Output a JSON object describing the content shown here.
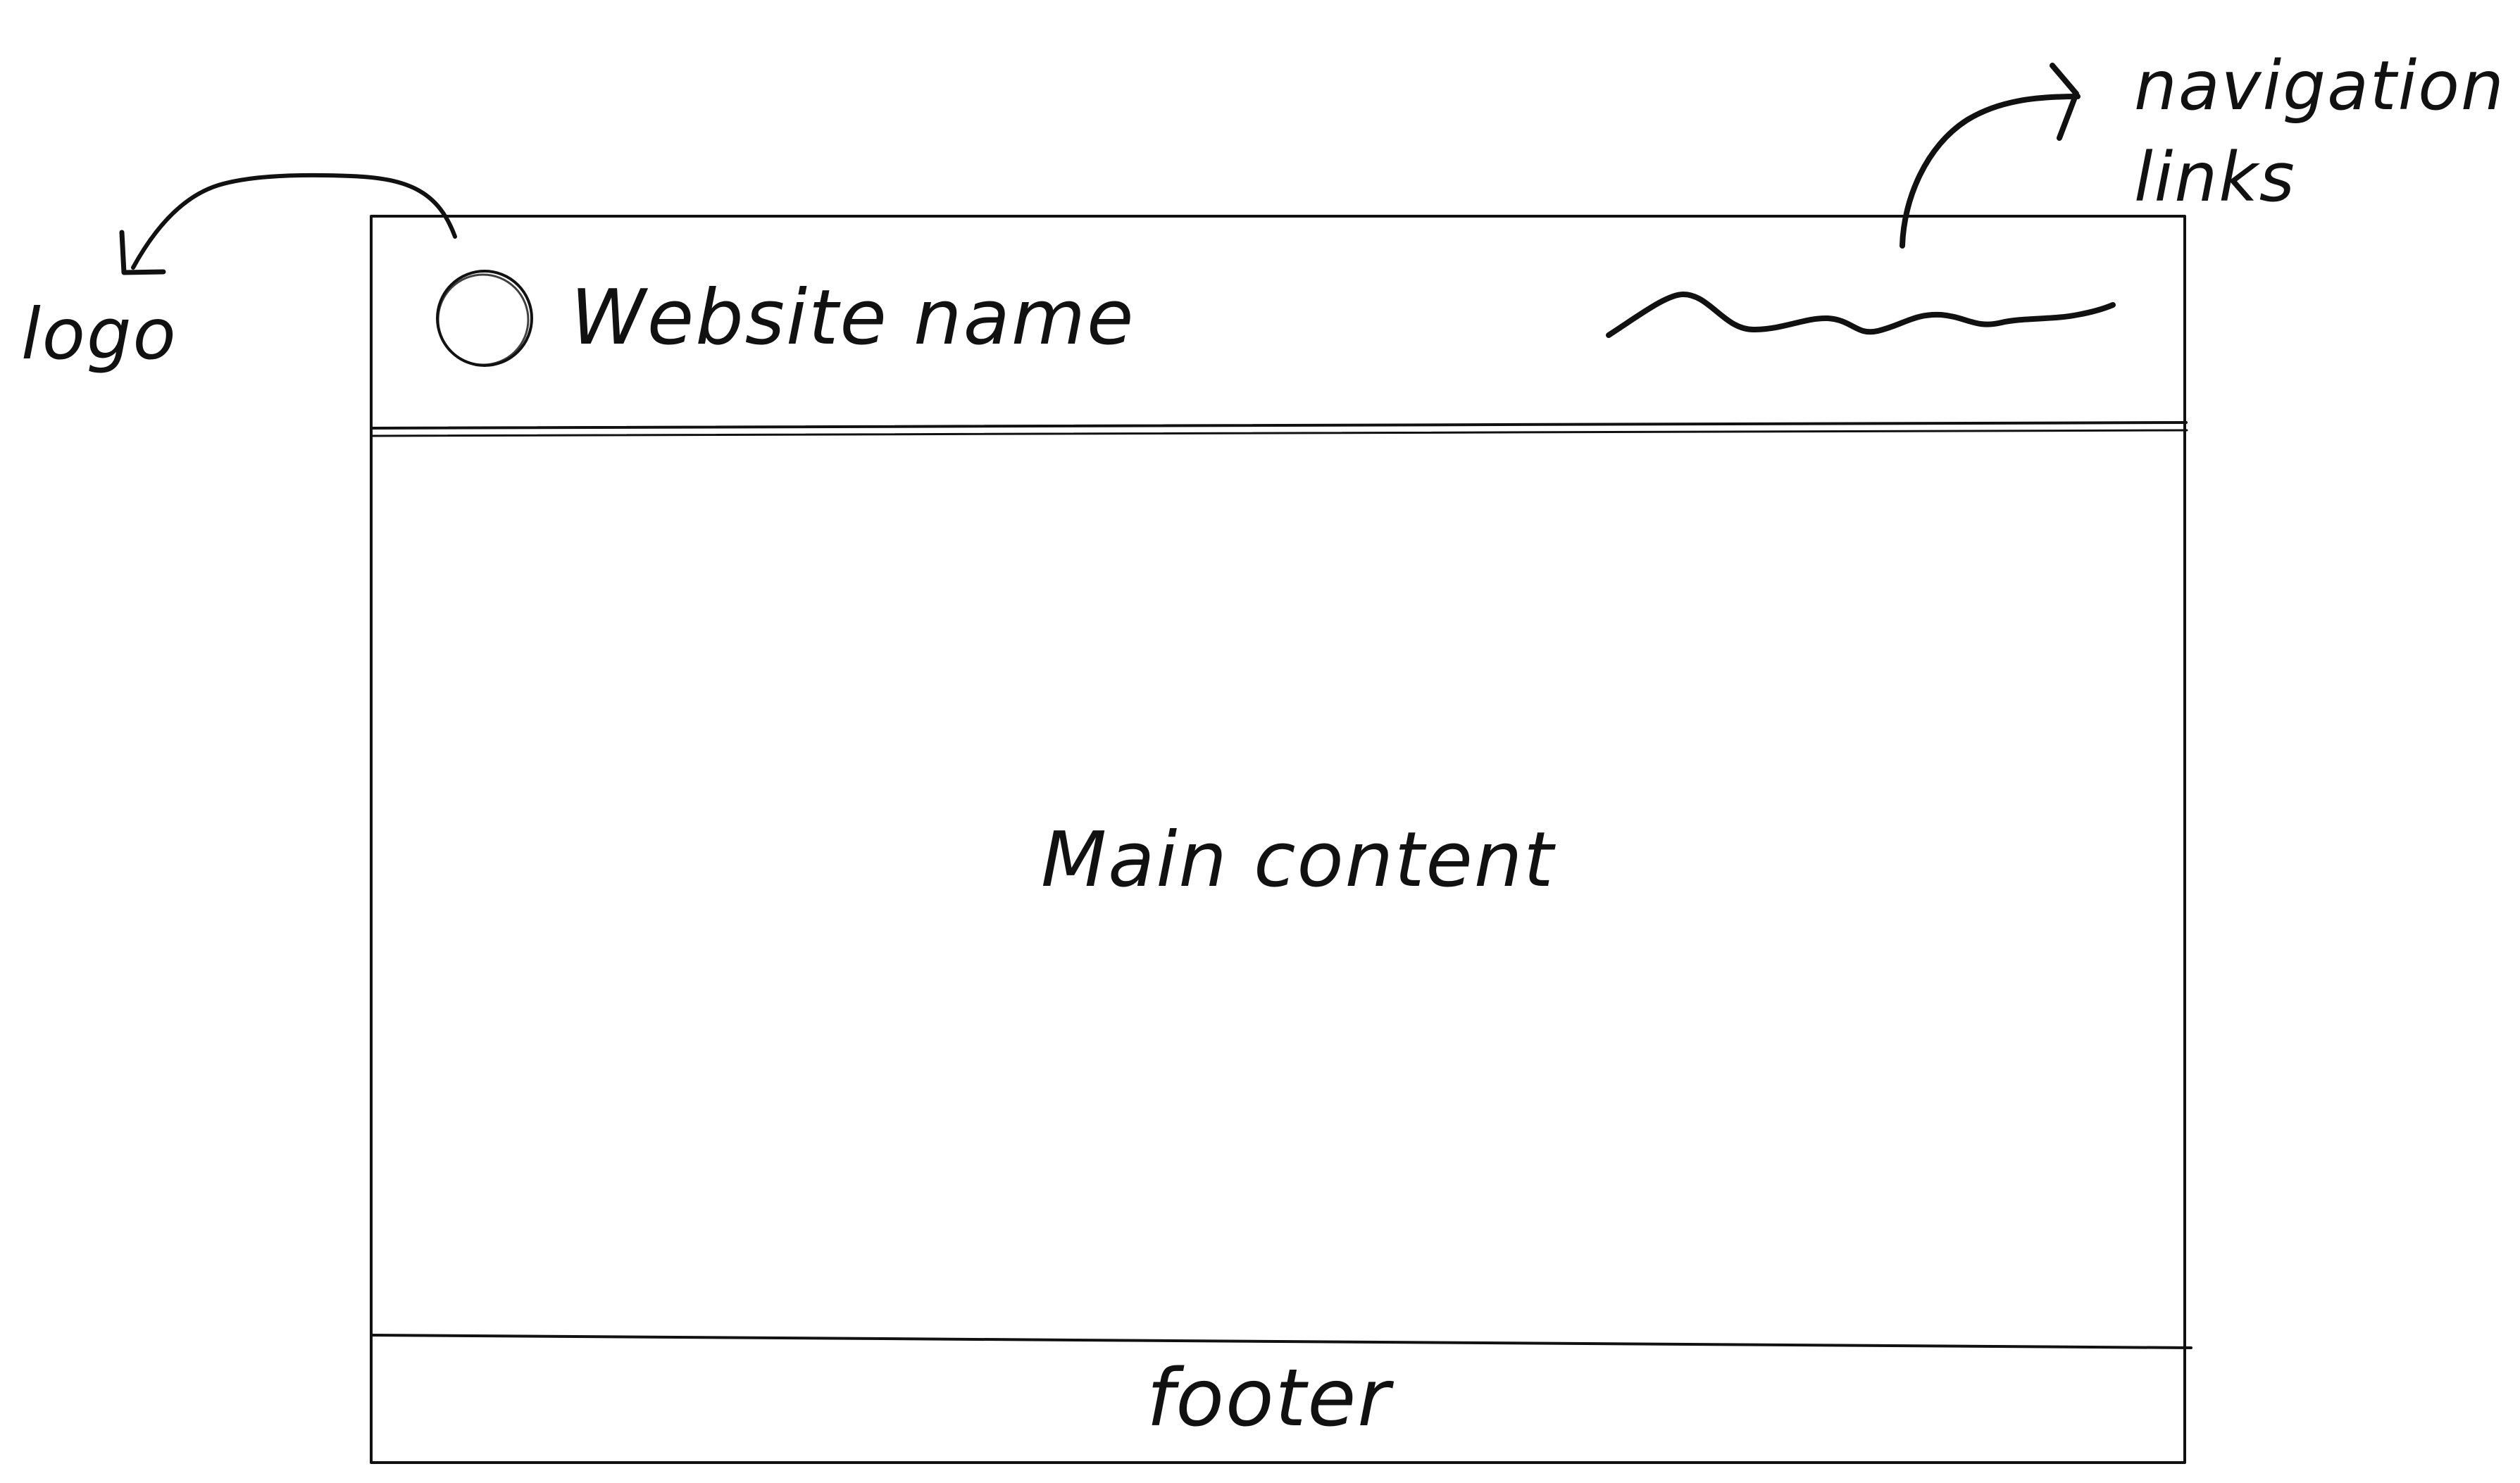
{
  "wireframe": {
    "site_name": "Website name",
    "main_content": "Main content",
    "footer": "footer"
  },
  "annotations": {
    "logo": "logo",
    "navigation_links_line1": "navigation",
    "navigation_links_line2": "links"
  },
  "icons": {
    "logo_shape": "circle-logo-icon",
    "nav_scribble": "scribble-navigation-icon",
    "arrow_logo": "curved-arrow-icon",
    "arrow_nav": "curved-arrow-icon"
  },
  "colors": {
    "ink": "#111111",
    "background": "#ffffff"
  }
}
